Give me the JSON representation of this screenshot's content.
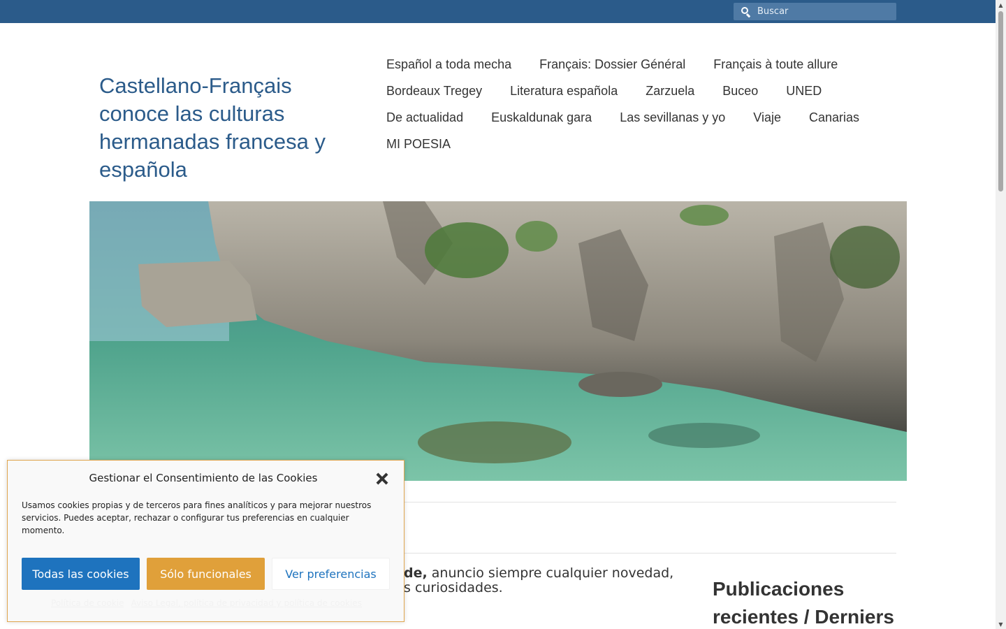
{
  "topbar": {
    "search_placeholder": "Buscar",
    "bg_color": "#2b5b8a"
  },
  "site": {
    "title": "Castellano-Français conoce las culturas hermanadas francesa y española"
  },
  "nav": {
    "items": [
      "Español a toda mecha",
      "Français: Dossier Général",
      "Français à toute allure",
      "Bordeaux Tregey",
      "Literatura española",
      "Zarzuela",
      "Buceo",
      "UNED",
      "De actualidad",
      "Euskaldunak gara",
      "Las sevillanas y yo",
      "Viaje",
      "Canarias",
      "MI POESIA"
    ]
  },
  "content": {
    "post_bold": "de,",
    "post_line1": " anuncio siempre cualquier novedad,",
    "post_line2": "s curiosidades."
  },
  "sidebar": {
    "heading": "Publicaciones recientes / Derniers"
  },
  "cookie": {
    "title": "Gestionar el Consentimiento de las Cookies",
    "text": "Usamos cookies propias y de terceros para fines analíticos y para mejorar nuestros servicios. Puedes aceptar, rechazar o configurar tus preferencias en cualquier momento.",
    "btn_all": "Todas las cookies",
    "btn_functional": "Sólo funcionales",
    "btn_prefs": "Ver preferencias",
    "link_policy": "Política de cookie",
    "link_legal": "Aviso Legal, política de privacidad y política de cookies",
    "border_color": "#e0a64f",
    "btn_all_color": "#1e73be",
    "btn_functional_color": "#e0a03a"
  }
}
